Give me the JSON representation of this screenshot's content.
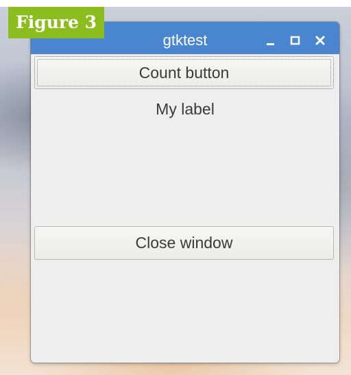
{
  "figure_label": "Figure 3",
  "window": {
    "title": "gtktest",
    "controls": {
      "minimize_icon": "minimize-icon",
      "maximize_icon": "maximize-icon",
      "close_icon": "close-icon"
    }
  },
  "content": {
    "count_button_label": "Count button",
    "label_text": "My label",
    "close_button_label": "Close window"
  },
  "colors": {
    "titlebar": "#4a86cf",
    "window_bg": "#eeeeee",
    "figure_badge": "#8cbd1e"
  }
}
